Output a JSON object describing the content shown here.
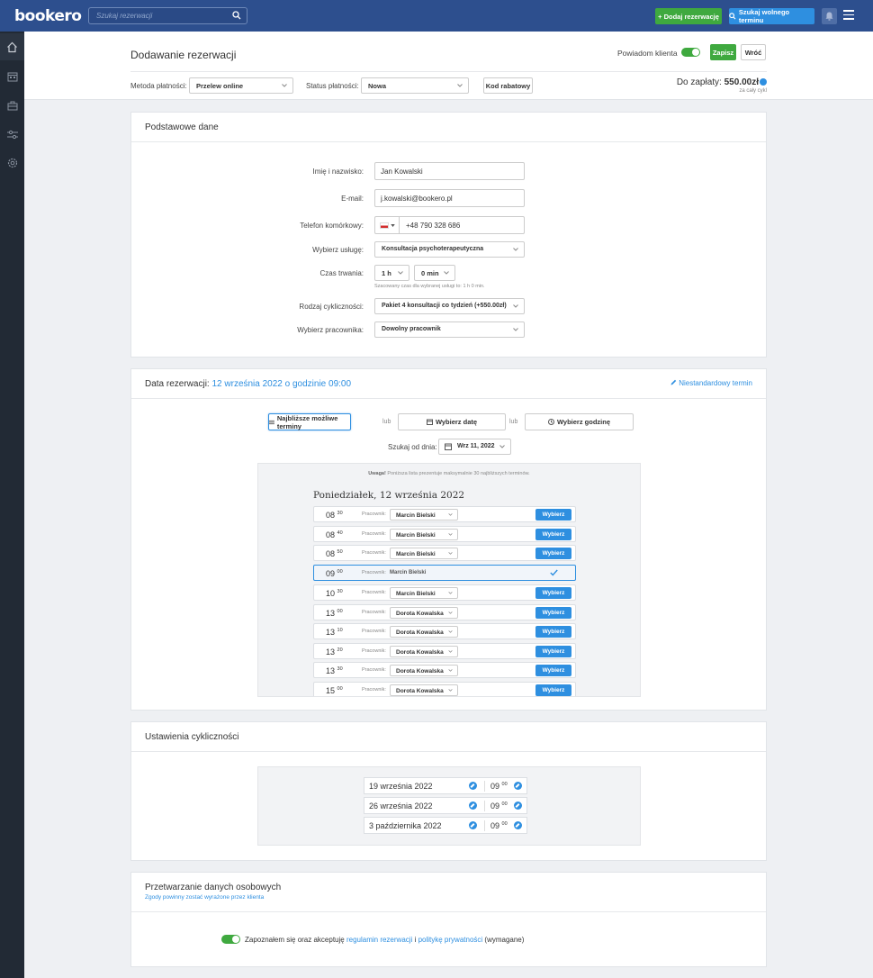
{
  "topbar": {
    "logo": "bookero",
    "search_placeholder": "Szukaj rezerwacji",
    "add_booking": "+ Dodaj rezerwację",
    "find_slot": "Szukaj wolnego terminu"
  },
  "sidebar": {
    "items": [
      "home-icon",
      "calendar-icon",
      "briefcase-icon",
      "sliders-icon",
      "gear-icon"
    ]
  },
  "header": {
    "title": "Dodawanie rezerwacji",
    "notify_label": "Powiadom klienta",
    "notify_on": true,
    "save": "Zapisz",
    "back": "Wróć",
    "payment_method_label": "Metoda płatności:",
    "payment_method_value": "Przelew online",
    "payment_status_label": "Status płatności:",
    "payment_status_value": "Nowa",
    "discount_code": "Kod rabatowy",
    "to_pay_label": "Do zapłaty:",
    "to_pay_value": "550.00zł",
    "to_pay_sub": "za cały cykl"
  },
  "basic": {
    "title": "Podstawowe dane",
    "name_label": "Imię i nazwisko:",
    "name_value": "Jan Kowalski",
    "email_label": "E-mail:",
    "email_value": "j.kowalski@bookero.pl",
    "phone_label": "Telefon komórkowy:",
    "phone_value": "+48 790 328 686",
    "service_label": "Wybierz usługę:",
    "service_value": "Konsultacja psychoterapeutyczna",
    "duration_label": "Czas trwania:",
    "duration_h": "1 h",
    "duration_m": "0 min",
    "duration_hint": "Szacowany czas dla wybranej usługi to: 1 h 0 min.",
    "cycle_label": "Rodzaj cykliczności:",
    "cycle_value": "Pakiet 4 konsultacji co tydzień (+550.00zł)",
    "worker_label": "Wybierz pracownika:",
    "worker_value": "Dowolny pracownik"
  },
  "date": {
    "title_prefix": "Data rezerwacji:",
    "title_value": "12 września 2022 o godzinie 09:00",
    "custom_term": "Niestandardowy termin",
    "btn_nearest": "Najbliższe możliwe terminy",
    "or1": "lub",
    "btn_pick_date": "Wybierz datę",
    "or2": "lub",
    "btn_pick_hour": "Wybierz godzinę",
    "search_from_label": "Szukaj od dnia:",
    "search_from_value": "Wrz 11, 2022",
    "note_bold": "Uwaga!",
    "note": "Poniższa lista prezentuje maksymalnie 30 najbliższych terminów.",
    "day_heading": "Poniedziałek, 12 września 2022",
    "worker_label": "Pracownik:",
    "choose": "Wybierz",
    "slots": [
      {
        "h": "08",
        "m": "30",
        "worker": "Marcin Bielski"
      },
      {
        "h": "08",
        "m": "40",
        "worker": "Marcin Bielski"
      },
      {
        "h": "08",
        "m": "50",
        "worker": "Marcin Bielski"
      },
      {
        "h": "09",
        "m": "00",
        "worker": "Marcin Bielski",
        "selected": true
      },
      {
        "h": "10",
        "m": "30",
        "worker": "Marcin Bielski"
      },
      {
        "h": "13",
        "m": "00",
        "worker": "Dorota Kowalska"
      },
      {
        "h": "13",
        "m": "10",
        "worker": "Dorota Kowalska"
      },
      {
        "h": "13",
        "m": "20",
        "worker": "Dorota Kowalska"
      },
      {
        "h": "13",
        "m": "30",
        "worker": "Dorota Kowalska"
      },
      {
        "h": "15",
        "m": "00",
        "worker": "Dorota Kowalska"
      }
    ]
  },
  "cycle": {
    "title": "Ustawienia cykliczności",
    "rows": [
      {
        "date": "19 września 2022",
        "h": "09",
        "m": "00"
      },
      {
        "date": "26 września 2022",
        "h": "09",
        "m": "00"
      },
      {
        "date": "3 października 2022",
        "h": "09",
        "m": "00"
      }
    ]
  },
  "gdpr": {
    "title": "Przetwarzanie danych osobowych",
    "subtitle": "Zgody powinny zostać wyrażone przez klienta",
    "consent_pre": "Zapoznałem się oraz akceptuję",
    "consent_link1": "regulamin rezerwacji",
    "consent_and": "i",
    "consent_link2": "politykę prywatności",
    "consent_post": "(wymagane)",
    "consent_on": true
  },
  "colors": {
    "topbar": "#2d4f8e",
    "sidebar": "#222a35",
    "green": "#3fa93f",
    "blue": "#2e8fe0"
  }
}
